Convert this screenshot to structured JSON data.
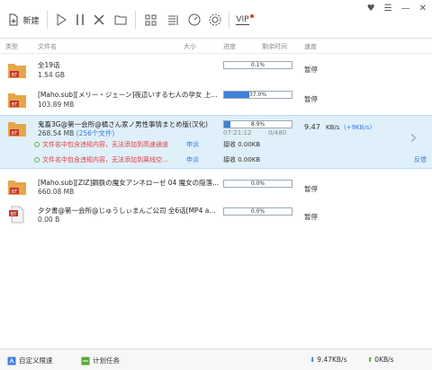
{
  "toolbar": {
    "new_label": "新建",
    "icons": [
      "new-icon",
      "play-icon",
      "pause-icon",
      "delete-icon",
      "folder-icon",
      "grid-view-icon",
      "sort-icon",
      "speed-icon",
      "settings-icon",
      "vip-icon"
    ],
    "vip_label": "VIP"
  },
  "window_controls": [
    "heart-icon",
    "menu-icon",
    "minimize-icon",
    "close-icon"
  ],
  "columns": [
    "类型",
    "文件名",
    "大小",
    "进度",
    "剩余时间",
    "速度"
  ],
  "tasks": [
    {
      "name": "全19话",
      "size": "1.54 GB",
      "progress_pct": 0.1,
      "progress_label": "0.1%",
      "status": "暂停"
    },
    {
      "name": "[Maho.sub][メリー・ジェーン]夜這いする七人の孕女 上...",
      "size": "103.89 MB",
      "progress_pct": 37.0,
      "progress_label": "37.0%",
      "status": "暂停"
    },
    {
      "name": "鬼畜3G@第一会所@橘さん家ノ男性事情まとめ版(汉化)",
      "size": "268.54 MB",
      "file_count": "(256个文件)",
      "progress_pct": 8.9,
      "progress_label": "8.9%",
      "time": "07:21:12",
      "total": "0/480",
      "speed": "9.47",
      "speed_unit": "KB/s",
      "speed_plus": "(+9KB/s)",
      "warnings": [
        {
          "text": "文件名中包含违规内容，无法添加到高速通道",
          "appeal": "申诉",
          "recv": "接收 0.00KB"
        },
        {
          "text": "文件名中包含违规内容，无法添加到离线空...",
          "appeal": "申诉",
          "recv": "接收 0.00KB"
        }
      ],
      "feedback": "反馈"
    },
    {
      "name": "[Maho.sub][ZIZ]鋼鉄の魔女アンネローゼ 04 魔女の隠落...",
      "size": "660.08 MB",
      "progress_pct": 0.0,
      "progress_label": "0.0%",
      "status": "暂停"
    },
    {
      "name": "夕夕書@第一会所@じゅうしぃまんご公司 全6话[MP4 a...",
      "size": "0.00 B",
      "progress_pct": 0.0,
      "progress_label": "0.0%",
      "status": "暂停"
    }
  ],
  "bottom": {
    "speed_limit": "自定义限速",
    "schedule": "计划任务",
    "down_speed": "9.47KB/s",
    "up_speed": "0KB/s"
  },
  "colors": {
    "accent": "#3d82d9",
    "warning": "#e23b3b",
    "selected_row": "#dff0fb"
  }
}
